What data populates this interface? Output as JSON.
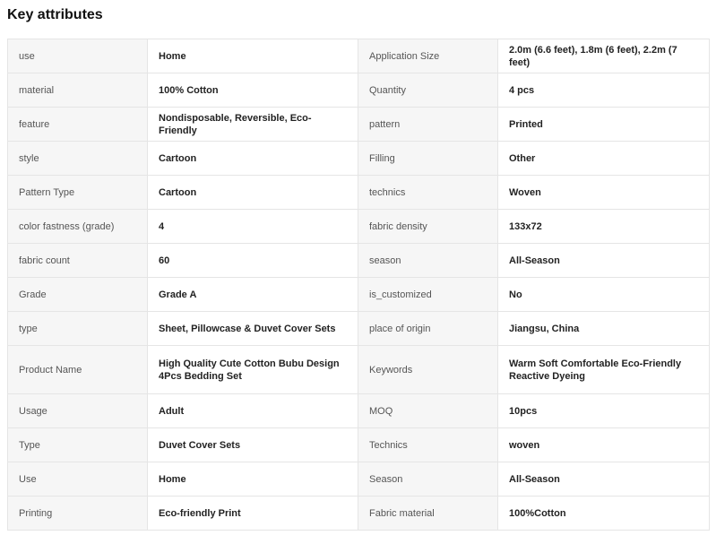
{
  "section": {
    "title": "Key attributes"
  },
  "rows": [
    {
      "l1": "use",
      "v1": "Home",
      "l2": "Application Size",
      "v2": "2.0m (6.6 feet), 1.8m (6 feet), 2.2m (7 feet)"
    },
    {
      "l1": "material",
      "v1": "100% Cotton",
      "l2": "Quantity",
      "v2": "4 pcs"
    },
    {
      "l1": "feature",
      "v1": "Nondisposable, Reversible, Eco-Friendly",
      "l2": "pattern",
      "v2": "Printed"
    },
    {
      "l1": "style",
      "v1": "Cartoon",
      "l2": "Filling",
      "v2": "Other"
    },
    {
      "l1": "Pattern Type",
      "v1": "Cartoon",
      "l2": "technics",
      "v2": "Woven"
    },
    {
      "l1": "color fastness (grade)",
      "v1": "4",
      "l2": "fabric density",
      "v2": "133x72"
    },
    {
      "l1": "fabric count",
      "v1": "60",
      "l2": "season",
      "v2": "All-Season"
    },
    {
      "l1": "Grade",
      "v1": "Grade A",
      "l2": "is_customized",
      "v2": "No"
    },
    {
      "l1": "type",
      "v1": "Sheet, Pillowcase & Duvet Cover Sets",
      "l2": "place of origin",
      "v2": "Jiangsu, China"
    },
    {
      "l1": "Product Name",
      "v1": "High Quality Cute Cotton Bubu Design 4Pcs Bedding Set",
      "l2": "Keywords",
      "v2": "Warm Soft Comfortable Eco-Friendly Reactive Dyeing"
    },
    {
      "l1": "Usage",
      "v1": "Adult",
      "l2": "MOQ",
      "v2": "10pcs"
    },
    {
      "l1": "Type",
      "v1": "Duvet Cover Sets",
      "l2": "Technics",
      "v2": "woven"
    },
    {
      "l1": "Use",
      "v1": "Home",
      "l2": "Season",
      "v2": "All-Season"
    },
    {
      "l1": "Printing",
      "v1": "Eco-friendly Print",
      "l2": "Fabric material",
      "v2": "100%Cotton"
    }
  ]
}
